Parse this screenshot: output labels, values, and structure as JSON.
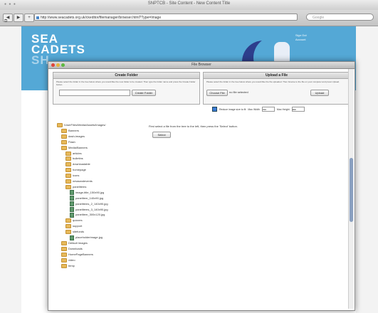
{
  "browser": {
    "title": "SNPTCB - Site Content - New Content Title",
    "url": "http://www.seacadets.org.uk/ckeditor/filemanager/browser.html?Type=Image",
    "search_placeholder": "Google",
    "nav": [
      "◀",
      "▶",
      "+"
    ]
  },
  "site": {
    "logo_line1": "SEA",
    "logo_line2": "CADETS",
    "logo_line3": "SH",
    "header_links": [
      "Sign Out",
      "Account"
    ]
  },
  "file_browser": {
    "title": "File Browser",
    "create_folder": {
      "heading": "Create Folder",
      "help": "Please select the folder in the tree below where you would like the new folder to be created. Then type the folder name and press the Create Folder button.",
      "button": "Create Folder"
    },
    "upload": {
      "heading": "Upload a File",
      "help": "Please select the folder in the tree below where you would like the file uploaded. Then browse to the file on your computer and press Upload.",
      "choose_button": "Choose File",
      "no_file": "no file selected",
      "upload_button": "Upload"
    },
    "resize": {
      "label": "Reduce image size to fit",
      "max_width_label": "Max Width",
      "max_width": "700",
      "max_height_label": "Max Height",
      "max_height": "900"
    },
    "instruction": "First select a file from the tree to the left, then press the 'Select' button.",
    "select_button": "Select",
    "tree": [
      {
        "label": "/UserFiles/Media/Assets/Images/",
        "type": "folder"
      },
      {
        "label": "Banners",
        "type": "folder"
      },
      {
        "label": "dash-images",
        "type": "folder"
      },
      {
        "label": "Flash",
        "type": "folder"
      },
      {
        "label": "Media/Banners",
        "type": "folder"
      },
      {
        "label": "articles",
        "type": "folder"
      },
      {
        "label": "bulletins",
        "type": "folder"
      },
      {
        "label": "downloadable",
        "type": "folder"
      },
      {
        "label": "homepage",
        "type": "folder"
      },
      {
        "label": "icons",
        "type": "folder"
      },
      {
        "label": "newsandevents",
        "type": "folder"
      },
      {
        "label": "panelitems",
        "type": "folder"
      },
      {
        "label": "image-title_150x90.jpg",
        "type": "file"
      },
      {
        "label": "panelitem_140x90.jpg",
        "type": "file"
      },
      {
        "label": "panelitems_2_140x90.jpg",
        "type": "file"
      },
      {
        "label": "panelitems_3_140x90.jpg",
        "type": "file"
      },
      {
        "label": "panelitem_300x120.jpg",
        "type": "file"
      },
      {
        "label": "quizzes",
        "type": "folder"
      },
      {
        "label": "support",
        "type": "folder"
      },
      {
        "label": "sitefunds",
        "type": "folder"
      },
      {
        "label": "placeholderimage.jpg",
        "type": "file"
      },
      {
        "label": "Default Images",
        "type": "folder"
      },
      {
        "label": "Downloads",
        "type": "folder"
      },
      {
        "label": "HomePageBanners",
        "type": "folder"
      },
      {
        "label": "video",
        "type": "folder"
      },
      {
        "label": "temp",
        "type": "folder"
      }
    ]
  }
}
